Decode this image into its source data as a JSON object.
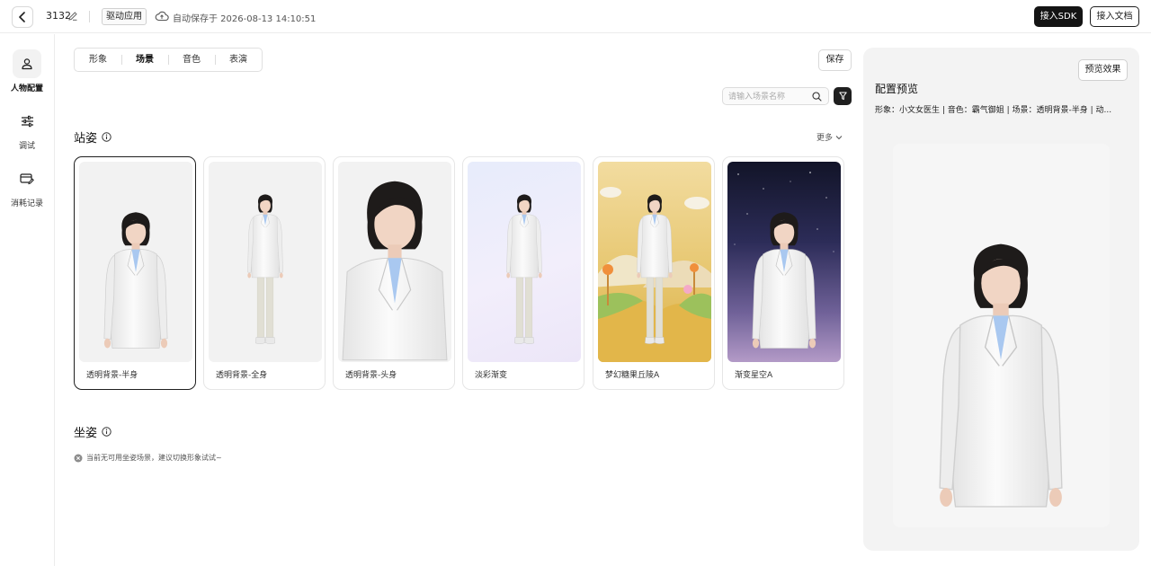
{
  "topbar": {
    "project_name": "3132",
    "app_tag": "驱动应用",
    "autosave_text": "自动保存于 2026-08-13 14:10:51",
    "sdk_button": "接入SDK",
    "doc_button": "接入文档"
  },
  "leftnav": {
    "items": [
      {
        "label": "人物配置",
        "icon": "person-icon",
        "active": true
      },
      {
        "label": "调试",
        "icon": "sliders-icon",
        "active": false
      },
      {
        "label": "消耗记录",
        "icon": "card-edit-icon",
        "active": false
      }
    ]
  },
  "main": {
    "tabs": [
      {
        "label": "形象",
        "active": false
      },
      {
        "label": "场景",
        "active": true
      },
      {
        "label": "音色",
        "active": false
      },
      {
        "label": "表演",
        "active": false
      }
    ],
    "save_button": "保存",
    "search": {
      "placeholder": "请输入场景名称",
      "value": ""
    },
    "standing": {
      "title": "站姿",
      "more": "更多",
      "cards": [
        {
          "label": "透明背景-半身",
          "selected": true,
          "background": "transparent",
          "framing": "half"
        },
        {
          "label": "透明背景-全身",
          "selected": false,
          "background": "transparent",
          "framing": "full"
        },
        {
          "label": "透明背景-头身",
          "selected": false,
          "background": "transparent",
          "framing": "head"
        },
        {
          "label": "淡彩渐变",
          "selected": false,
          "background": "pastel-gradient",
          "framing": "full"
        },
        {
          "label": "梦幻糖果丘陵A",
          "selected": false,
          "background": "candy-hills",
          "framing": "full"
        },
        {
          "label": "渐变星空A",
          "selected": false,
          "background": "starry-gradient",
          "framing": "half"
        }
      ]
    },
    "sitting": {
      "title": "坐姿",
      "empty_text": "当前无可用坐姿场景，建议切换形象试试~"
    }
  },
  "preview": {
    "button": "预览效果",
    "title": "配置预览",
    "summary": "形象：小文女医生 | 音色：霸气御姐 | 场景：透明背景-半身 | 动..."
  },
  "colors": {
    "primary_dark": "#141414",
    "border": "#e6e6e6",
    "panel_bg": "#f3f3f3",
    "coat": "#f4f4f4",
    "shirt": "#a9c8f0",
    "hair": "#1e1b1a"
  }
}
